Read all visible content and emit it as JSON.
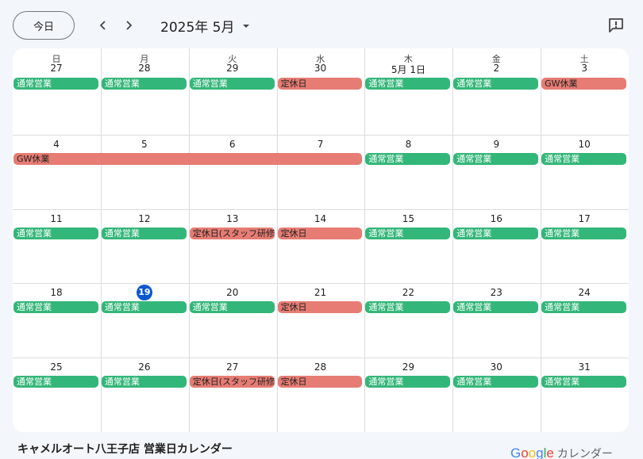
{
  "toolbar": {
    "today_label": "今日",
    "month_label": "2025年 5月"
  },
  "weekdays": [
    "日",
    "月",
    "火",
    "水",
    "木",
    "金",
    "土"
  ],
  "weeks": [
    {
      "dates": [
        "27",
        "28",
        "29",
        "30",
        "5月 1日",
        "2",
        "3"
      ]
    },
    {
      "dates": [
        "4",
        "5",
        "6",
        "7",
        "8",
        "9",
        "10"
      ]
    },
    {
      "dates": [
        "11",
        "12",
        "13",
        "14",
        "15",
        "16",
        "17"
      ]
    },
    {
      "dates": [
        "18",
        "19",
        "20",
        "21",
        "22",
        "23",
        "24"
      ]
    },
    {
      "dates": [
        "25",
        "26",
        "27",
        "28",
        "29",
        "30",
        "31"
      ]
    }
  ],
  "today": {
    "week": 3,
    "day": 1
  },
  "events": [
    {
      "week": 0,
      "start": 0,
      "span": 1,
      "title": "通常営業",
      "color": "green"
    },
    {
      "week": 0,
      "start": 1,
      "span": 1,
      "title": "通常営業",
      "color": "green"
    },
    {
      "week": 0,
      "start": 2,
      "span": 1,
      "title": "通常営業",
      "color": "green"
    },
    {
      "week": 0,
      "start": 3,
      "span": 1,
      "title": "定休日",
      "color": "red"
    },
    {
      "week": 0,
      "start": 4,
      "span": 1,
      "title": "通常営業",
      "color": "green"
    },
    {
      "week": 0,
      "start": 5,
      "span": 1,
      "title": "通常営業",
      "color": "green"
    },
    {
      "week": 0,
      "start": 6,
      "span": 1,
      "title": "GW休業",
      "color": "red"
    },
    {
      "week": 1,
      "start": 0,
      "span": 4,
      "title": "GW休業",
      "color": "red"
    },
    {
      "week": 1,
      "start": 4,
      "span": 1,
      "title": "通常営業",
      "color": "green"
    },
    {
      "week": 1,
      "start": 5,
      "span": 1,
      "title": "通常営業",
      "color": "green"
    },
    {
      "week": 1,
      "start": 6,
      "span": 1,
      "title": "通常営業",
      "color": "green"
    },
    {
      "week": 2,
      "start": 0,
      "span": 1,
      "title": "通常営業",
      "color": "green"
    },
    {
      "week": 2,
      "start": 1,
      "span": 1,
      "title": "通常営業",
      "color": "green"
    },
    {
      "week": 2,
      "start": 2,
      "span": 1,
      "title": "定休日(スタッフ研修)",
      "color": "red"
    },
    {
      "week": 2,
      "start": 3,
      "span": 1,
      "title": "定休日",
      "color": "red"
    },
    {
      "week": 2,
      "start": 4,
      "span": 1,
      "title": "通常営業",
      "color": "green"
    },
    {
      "week": 2,
      "start": 5,
      "span": 1,
      "title": "通常営業",
      "color": "green"
    },
    {
      "week": 2,
      "start": 6,
      "span": 1,
      "title": "通常営業",
      "color": "green"
    },
    {
      "week": 3,
      "start": 0,
      "span": 1,
      "title": "通常営業",
      "color": "green"
    },
    {
      "week": 3,
      "start": 1,
      "span": 1,
      "title": "通常営業",
      "color": "green"
    },
    {
      "week": 3,
      "start": 2,
      "span": 1,
      "title": "通常営業",
      "color": "green"
    },
    {
      "week": 3,
      "start": 3,
      "span": 1,
      "title": "定休日",
      "color": "red"
    },
    {
      "week": 3,
      "start": 4,
      "span": 1,
      "title": "通常営業",
      "color": "green"
    },
    {
      "week": 3,
      "start": 5,
      "span": 1,
      "title": "通常営業",
      "color": "green"
    },
    {
      "week": 3,
      "start": 6,
      "span": 1,
      "title": "通常営業",
      "color": "green"
    },
    {
      "week": 4,
      "start": 0,
      "span": 1,
      "title": "通常営業",
      "color": "green"
    },
    {
      "week": 4,
      "start": 1,
      "span": 1,
      "title": "通常営業",
      "color": "green"
    },
    {
      "week": 4,
      "start": 2,
      "span": 1,
      "title": "定休日(スタッフ研修)",
      "color": "red"
    },
    {
      "week": 4,
      "start": 3,
      "span": 1,
      "title": "定休日",
      "color": "red"
    },
    {
      "week": 4,
      "start": 4,
      "span": 1,
      "title": "通常営業",
      "color": "green"
    },
    {
      "week": 4,
      "start": 5,
      "span": 1,
      "title": "通常営業",
      "color": "green"
    },
    {
      "week": 4,
      "start": 6,
      "span": 1,
      "title": "通常営業",
      "color": "green"
    }
  ],
  "colors": {
    "green": "#33b679",
    "red": "#e67c73",
    "today": "#0b57d0"
  },
  "icons": {
    "prev": "chevron-left-icon",
    "next": "chevron-right-icon",
    "dropdown": "arrow-drop-down-icon",
    "feedback": "feedback-icon"
  },
  "footer": {
    "calendar_title": "キャメルオート八王子店 営業日カレンダー",
    "brand_google": "Google",
    "brand_suffix": "カレンダー"
  }
}
